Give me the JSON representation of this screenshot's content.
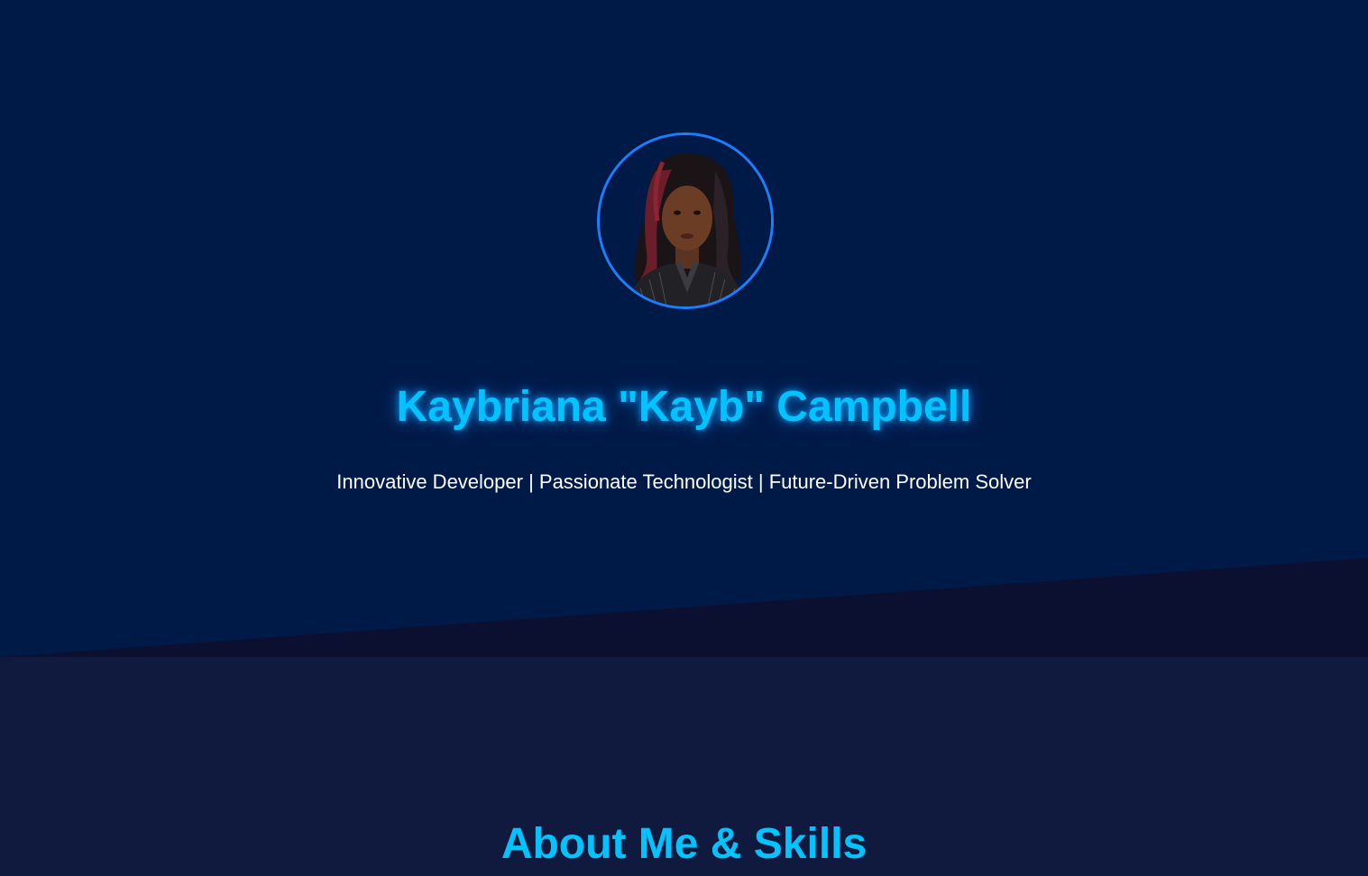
{
  "hero": {
    "name": "Kaybriana \"Kayb\" Campbell",
    "tagline": "Innovative Developer | Passionate Technologist | Future-Driven Problem Solver",
    "avatar_alt": "profile photo"
  },
  "about": {
    "title": "About Me & Skills"
  },
  "colors": {
    "hero_bg": "#001a47",
    "about_bg": "#0f1a3e",
    "slant": "#0c1030",
    "accent": "#00c3ff",
    "avatar_border": "#1a7fff",
    "text": "#ffffff"
  }
}
